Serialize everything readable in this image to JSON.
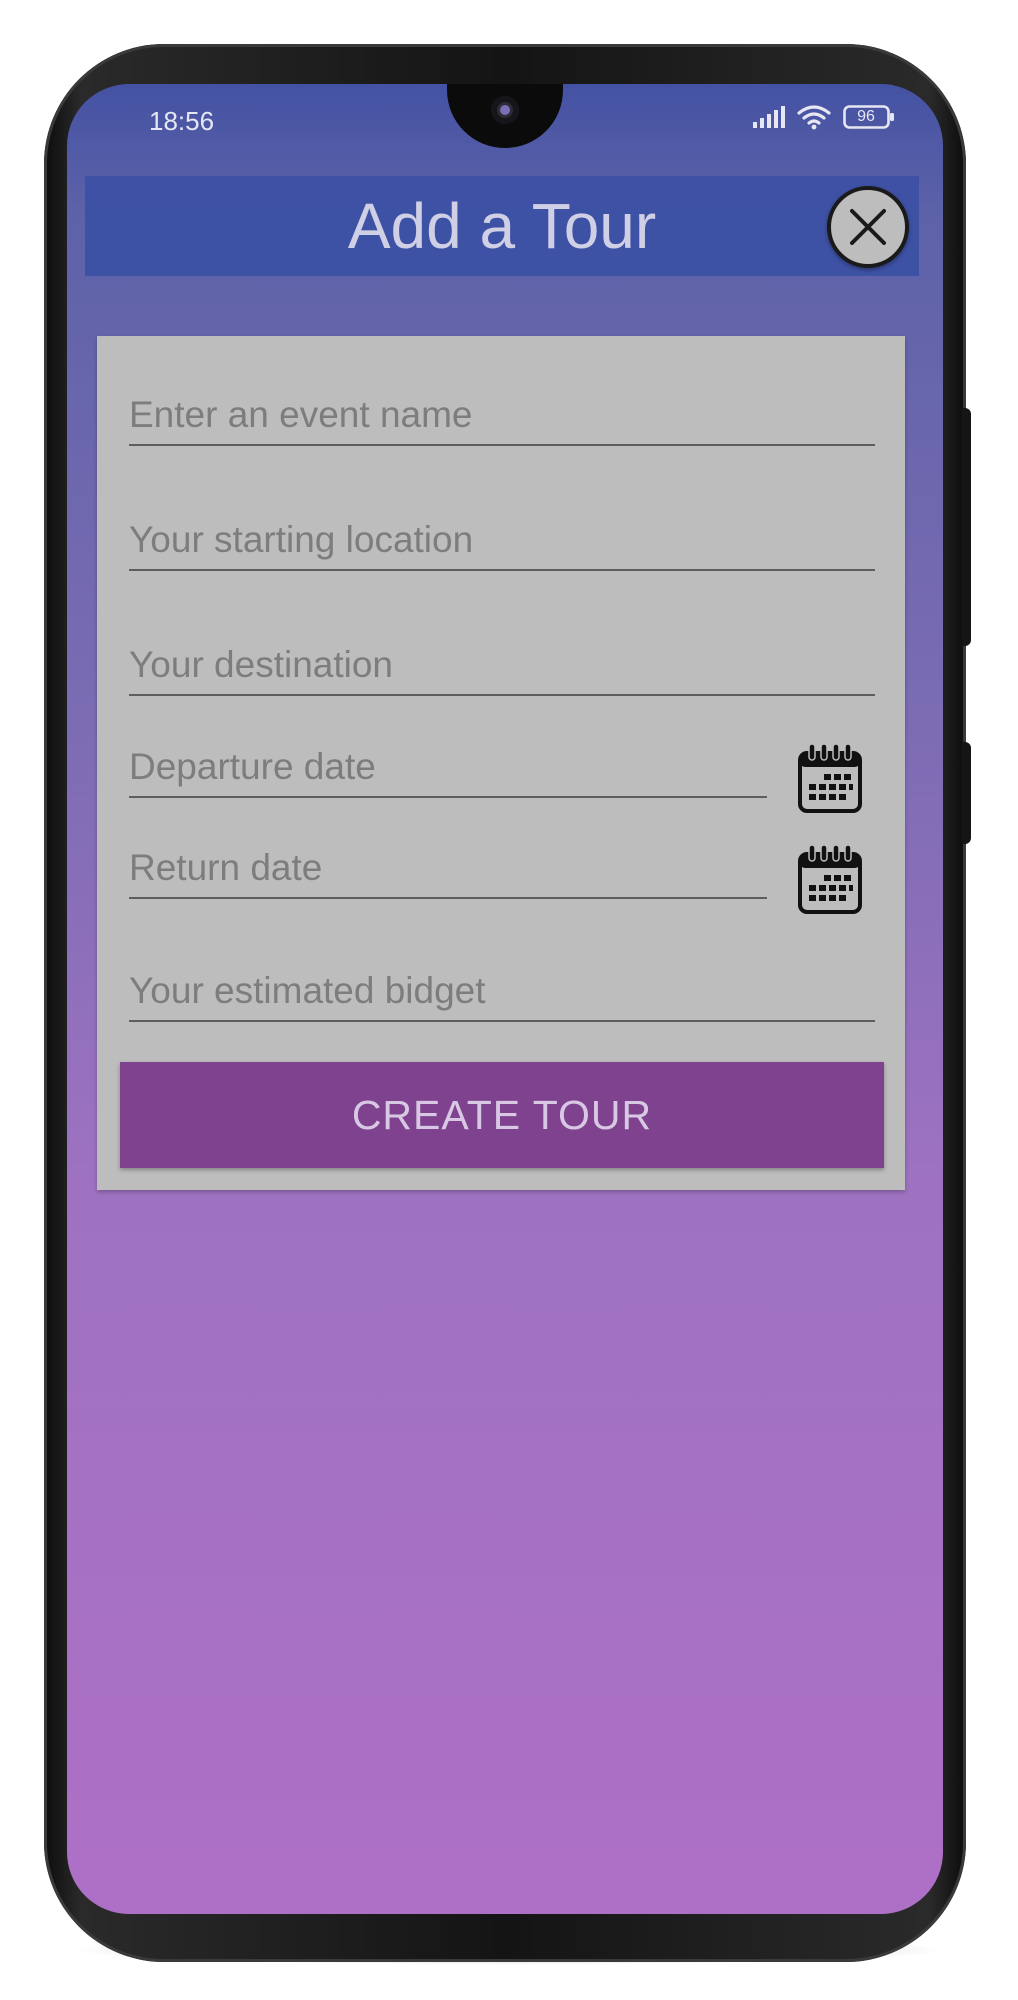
{
  "status_bar": {
    "time": "18:56",
    "battery": "96",
    "icons": [
      "signal-icon",
      "wifi-icon",
      "battery-icon"
    ]
  },
  "header": {
    "title": "Add a Tour",
    "close_icon": "close-icon"
  },
  "form": {
    "event_name": {
      "placeholder": "Enter an event name",
      "value": ""
    },
    "starting_location": {
      "placeholder": "Your starting location",
      "value": ""
    },
    "destination": {
      "placeholder": "Your destination",
      "value": ""
    },
    "departure_date": {
      "placeholder": "Departure date",
      "value": "",
      "icon": "calendar-icon"
    },
    "return_date": {
      "placeholder": "Return date",
      "value": "",
      "icon": "calendar-icon"
    },
    "budget": {
      "placeholder": "Your estimated bidget",
      "value": ""
    },
    "submit_label": "CREATE TOUR"
  },
  "colors": {
    "header": "#3c50a5",
    "card": "#bdbdbd",
    "button": "#7e428f",
    "gradient_top": "#4452a3",
    "gradient_bottom": "#ae70c6"
  }
}
